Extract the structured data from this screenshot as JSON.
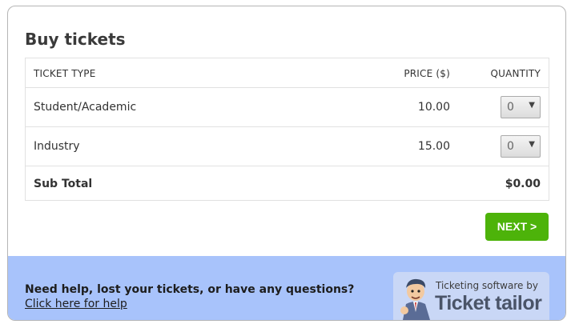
{
  "title": "Buy tickets",
  "table": {
    "headers": {
      "type": "TICKET TYPE",
      "price": "PRICE ($)",
      "quantity": "QUANTITY"
    },
    "rows": [
      {
        "type": "Student/Academic",
        "price": "10.00",
        "quantity": "0"
      },
      {
        "type": "Industry",
        "price": "15.00",
        "quantity": "0"
      }
    ],
    "subtotal": {
      "label": "Sub Total",
      "value": "$0.00"
    }
  },
  "next_button": "NEXT >",
  "footer": {
    "help_question": "Need help, lost your tickets, or have any questions?",
    "help_link": "Click here for help",
    "badge_small": "Ticketing software by",
    "badge_brand": "Ticket tailor"
  },
  "colors": {
    "next_button": "#4db30a",
    "footer_bg": "#a8c3fb",
    "badge_bg": "#c9d7f6"
  },
  "icons": {
    "select_arrow": "chevron-down-icon",
    "badge_logo": "mascot-logo-icon"
  }
}
